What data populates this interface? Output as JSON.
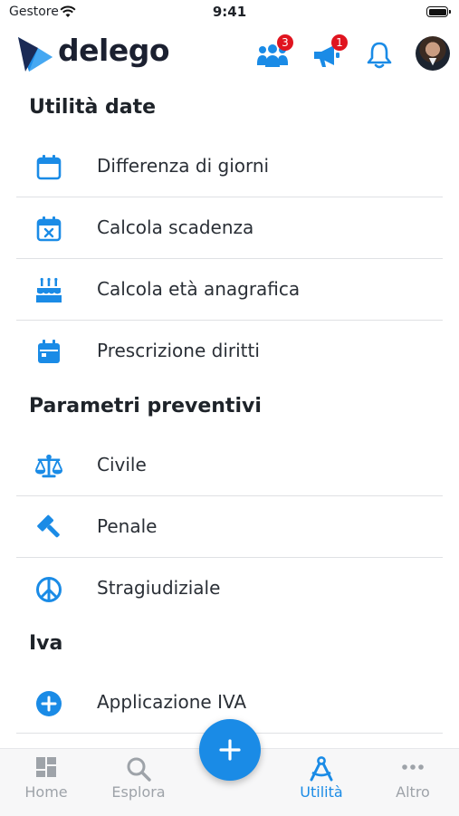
{
  "status_bar": {
    "carrier": "Gestore",
    "time": "9:41"
  },
  "header": {
    "logo_text": "delego",
    "community_badge": "3",
    "announcements_badge": "1"
  },
  "sections": [
    {
      "title": "Utilità date",
      "items": [
        {
          "label": "Differenza di giorni",
          "icon": "calendar-icon"
        },
        {
          "label": "Calcola scadenza",
          "icon": "calendar-x-icon"
        },
        {
          "label": "Calcola età anagrafica",
          "icon": "birthday-cake-icon"
        },
        {
          "label": "Prescrizione diritti",
          "icon": "calendar-filled-icon"
        }
      ]
    },
    {
      "title": "Parametri preventivi",
      "items": [
        {
          "label": "Civile",
          "icon": "scales-icon"
        },
        {
          "label": "Penale",
          "icon": "gavel-icon"
        },
        {
          "label": "Stragiudiziale",
          "icon": "peace-icon"
        }
      ]
    },
    {
      "title": "Iva",
      "items": [
        {
          "label": "Applicazione IVA",
          "icon": "plus-circle-icon"
        }
      ]
    }
  ],
  "tabbar": {
    "home": "Home",
    "explore": "Esplora",
    "utilities": "Utilità",
    "more": "Altro",
    "active": "utilities"
  },
  "colors": {
    "accent": "#1a8be6",
    "badge": "#e0141f",
    "text": "#2a2f36",
    "inactive_tab": "#9ea3a9"
  }
}
